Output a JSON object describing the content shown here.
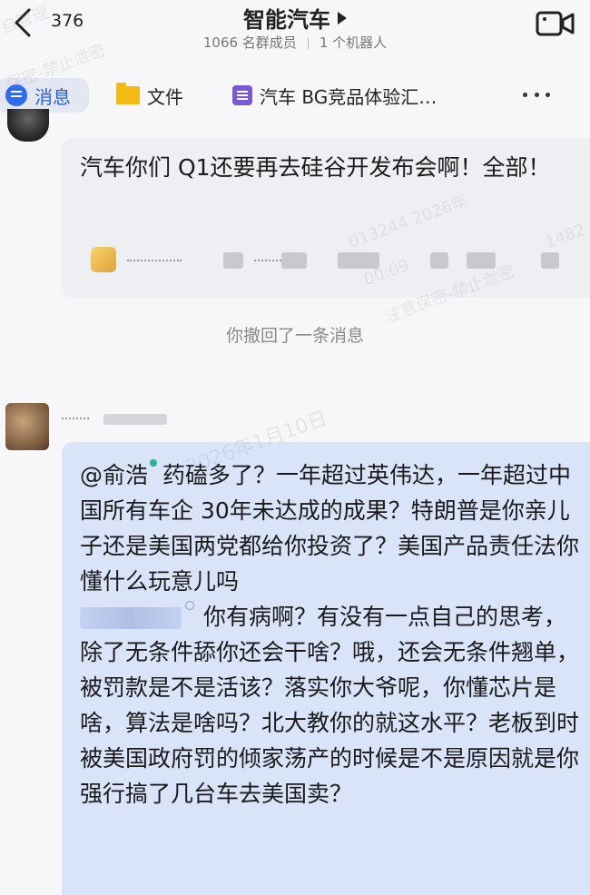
{
  "header": {
    "unread_count": "376",
    "group_title": "智能汽车",
    "member_count": "1066 名群成员",
    "robot_count": "1 个机器人"
  },
  "tabs": [
    {
      "label": "消息",
      "icon": "message-icon"
    },
    {
      "label": "文件",
      "icon": "folder-icon"
    },
    {
      "label": "汽车 BG竞品体验汇…",
      "icon": "doc-icon"
    }
  ],
  "messages": {
    "first": {
      "text": "汽车你们 Q1还要再去硅谷开发布会啊！全部！"
    },
    "recall_notice": "你撤回了一条消息",
    "second": {
      "mention": "@俞浩",
      "line1": "药磕多了？一年超过英伟达，一年超过中国所有车企 30年未达成的成果？特朗普是你亲儿子还是美国两党都给你投资了？美国产品责任法你懂什么玩意儿吗",
      "line2": "你有病啊？有没有一点自己的思考，除了无条件舔你还会干啥？哦，还会无条件翘单，被罚款是不是活该？落实你大爷呢，你懂芯片是啥，算法是啥吗？北大教你的就这水平？老板到时被美国政府罚的倾家荡产的时候是不是原因就是你强行搞了几台车去美国卖？"
    }
  },
  "watermarks": [
    "自管理",
    "保密-禁止泄密",
    "2026年1月10日",
    "013244 2026年",
    "00:09",
    "注意保密-禁止泄密",
    "1482"
  ],
  "colors": {
    "accent": "#2f6bf0",
    "bubble_self": "#d9e4f9",
    "bubble_other": "#eeeff3",
    "mention_dot": "#2ab08a"
  }
}
